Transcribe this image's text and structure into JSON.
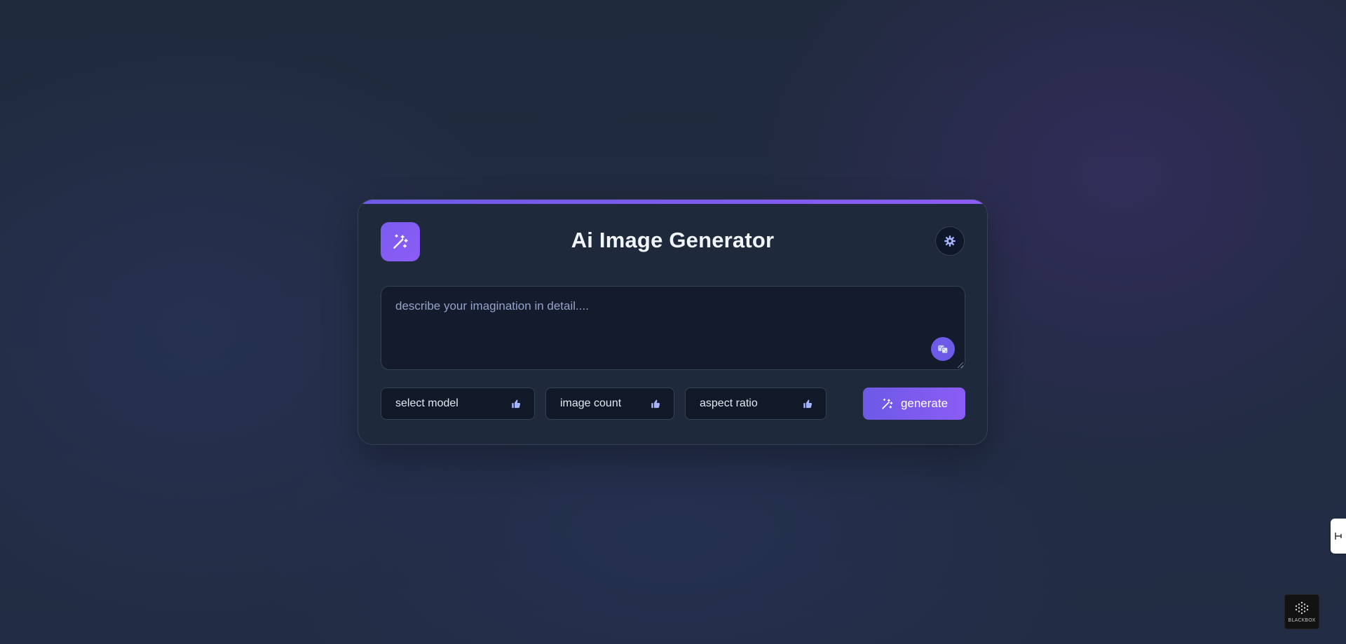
{
  "app": {
    "title": "Ai Image Generator"
  },
  "prompt": {
    "placeholder": "describe your imagination in detail....",
    "value": ""
  },
  "controls": {
    "model_label": "select model",
    "count_label": "image count",
    "ratio_label": "aspect ratio",
    "generate_label": "generate"
  },
  "badge": {
    "label": "BLACKBOX"
  },
  "icons": {
    "logo": "magic-wand-icon",
    "theme": "gear-icon",
    "random_prompt": "dice-icon",
    "dropdown": "thumbs-up-icon",
    "generate": "magic-wand-icon",
    "side_tab": "collapse-icon"
  },
  "colors": {
    "accent": "#6d5ae6",
    "accent_light": "#8b5cf6",
    "card_bg": "#1e293b",
    "page_bg": "#222d45",
    "text": "#f1f5f9"
  }
}
